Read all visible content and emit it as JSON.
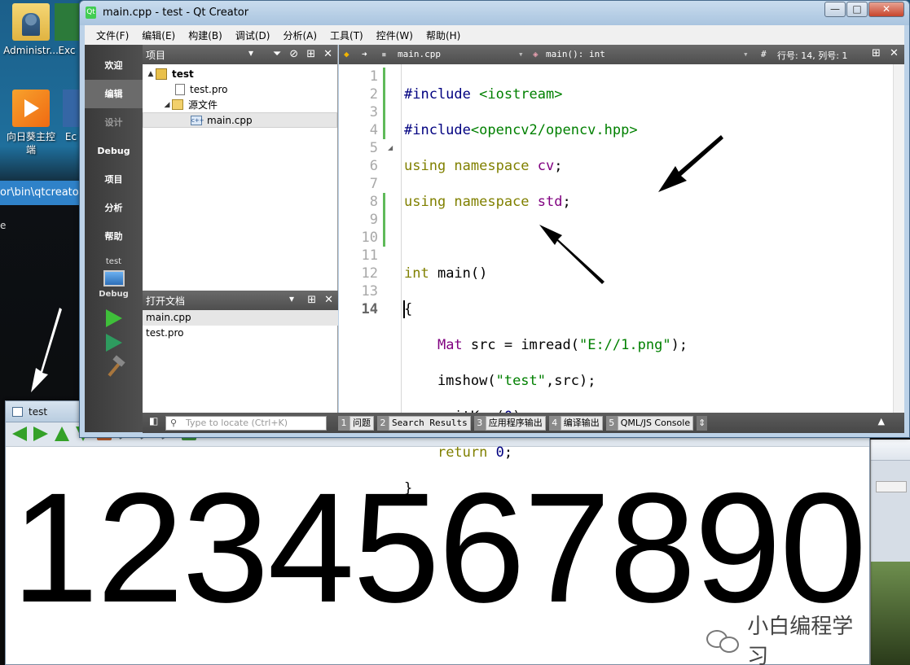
{
  "desktop": {
    "icons": [
      {
        "label": "Administr..."
      },
      {
        "label": "Exc"
      },
      {
        "label": "向日葵主控端"
      },
      {
        "label": "Ec"
      }
    ],
    "path_strip": "or\\bin\\qtcreator_",
    "left_char": "e"
  },
  "qt": {
    "title": "main.cpp - test - Qt Creator",
    "window_buttons": {
      "minimize": "—",
      "maximize": "□",
      "close": "✕"
    },
    "menu": [
      "文件(F)",
      "编辑(E)",
      "构建(B)",
      "调试(D)",
      "分析(A)",
      "工具(T)",
      "控件(W)",
      "帮助(H)"
    ],
    "modes": [
      "欢迎",
      "编辑",
      "设计",
      "Debug",
      "项目",
      "分析",
      "帮助"
    ],
    "kit": {
      "project": "test",
      "config": "Debug"
    },
    "project_pane": {
      "title": "项目",
      "tree": [
        {
          "label": "test",
          "level": 0
        },
        {
          "label": "test.pro",
          "level": 1
        },
        {
          "label": "源文件",
          "level": 1
        },
        {
          "label": "main.cpp",
          "level": 2
        }
      ]
    },
    "open_docs": {
      "title": "打开文档",
      "items": [
        "main.cpp",
        "test.pro"
      ]
    },
    "editor": {
      "file": "main.cpp",
      "symbol": "main(): int",
      "hash": "#",
      "position": "行号: 14, 列号: 1",
      "lines": [
        "1",
        "2",
        "3",
        "4",
        "5",
        "6",
        "7",
        "8",
        "9",
        "10",
        "11",
        "12",
        "13",
        "14"
      ],
      "current_line": "14"
    },
    "locate_placeholder": "Type to locate (Ctrl+K)",
    "output_tabs": [
      {
        "num": "1",
        "label": "问题"
      },
      {
        "num": "2",
        "label": "Search Results"
      },
      {
        "num": "3",
        "label": "应用程序输出"
      },
      {
        "num": "4",
        "label": "编译输出"
      },
      {
        "num": "5",
        "label": "QML/JS Console"
      }
    ]
  },
  "image_window": {
    "title": "test",
    "image_text": "1234567890"
  },
  "watermark": "小白编程学习"
}
